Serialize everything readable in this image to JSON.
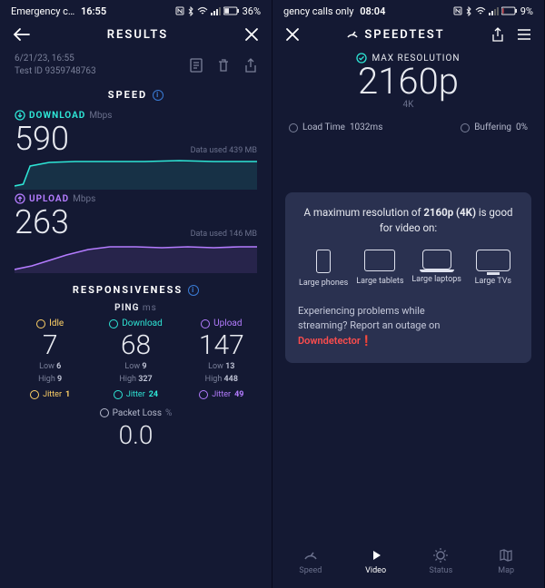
{
  "left": {
    "statusbar": {
      "carrier": "Emergency c…",
      "time": "16:55",
      "battery": "36%"
    },
    "appbar": {
      "title": "RESULTS"
    },
    "meta": {
      "date": "6/21/23, 16:55",
      "test_id": "Test ID 9359748763"
    },
    "speed_section_label": "SPEED",
    "download": {
      "label": "DOWNLOAD",
      "unit": "Mbps",
      "value": "590",
      "data_used": "Data used 439 MB"
    },
    "upload": {
      "label": "UPLOAD",
      "unit": "Mbps",
      "value": "263",
      "data_used": "Data used 146 MB"
    },
    "resp_section_label": "RESPONSIVENESS",
    "ping_label": "PING",
    "ping_unit": "ms",
    "idle": {
      "label": "Idle",
      "value": "7",
      "low": "6",
      "high": "9",
      "jitter": "1"
    },
    "dl": {
      "label": "Download",
      "value": "68",
      "low": "9",
      "high": "327",
      "jitter": "24"
    },
    "ul": {
      "label": "Upload",
      "value": "147",
      "low": "13",
      "high": "448",
      "jitter": "49"
    },
    "low_prefix": "Low",
    "high_prefix": "High",
    "jitter_prefix": "Jitter",
    "packet_loss": {
      "label": "Packet Loss",
      "unit": "%",
      "value": "0.0"
    }
  },
  "right": {
    "statusbar": {
      "carrier": "gency calls only",
      "time": "08:04",
      "battery": "9%"
    },
    "appbar": {
      "title": "SPEEDTEST"
    },
    "maxres": {
      "label": "MAX RESOLUTION",
      "value": "2160p",
      "sub": "4K"
    },
    "load": {
      "label": "Load Time",
      "value": "1032ms"
    },
    "buffer": {
      "label": "Buffering",
      "value": "0%"
    },
    "card": {
      "pretext": "A maximum resolution of ",
      "bold": "2160p (4K)",
      "posttext": " is good for video on:",
      "devices": [
        "Large phones",
        "Large tablets",
        "Large laptops",
        "Large TVs"
      ]
    },
    "outage": {
      "line1": "Experiencing problems while",
      "line2": "streaming? Report an outage on",
      "link": "Downdetector"
    },
    "nav": {
      "speed": "Speed",
      "video": "Video",
      "status": "Status",
      "map": "Map"
    }
  },
  "chart_data": [
    {
      "type": "line",
      "title": "Download",
      "ylabel": "Mbps",
      "ylim": [
        0,
        650
      ],
      "series": [
        {
          "name": "Download",
          "values": [
            120,
            560,
            580,
            600,
            590,
            595,
            600,
            598,
            595,
            592,
            594,
            596,
            598,
            600,
            600
          ]
        }
      ]
    },
    {
      "type": "line",
      "title": "Upload",
      "ylabel": "Mbps",
      "ylim": [
        0,
        320
      ],
      "series": [
        {
          "name": "Upload",
          "values": [
            80,
            120,
            160,
            210,
            255,
            262,
            268,
            263,
            260,
            258,
            260,
            259,
            261,
            260,
            260
          ]
        }
      ]
    }
  ]
}
